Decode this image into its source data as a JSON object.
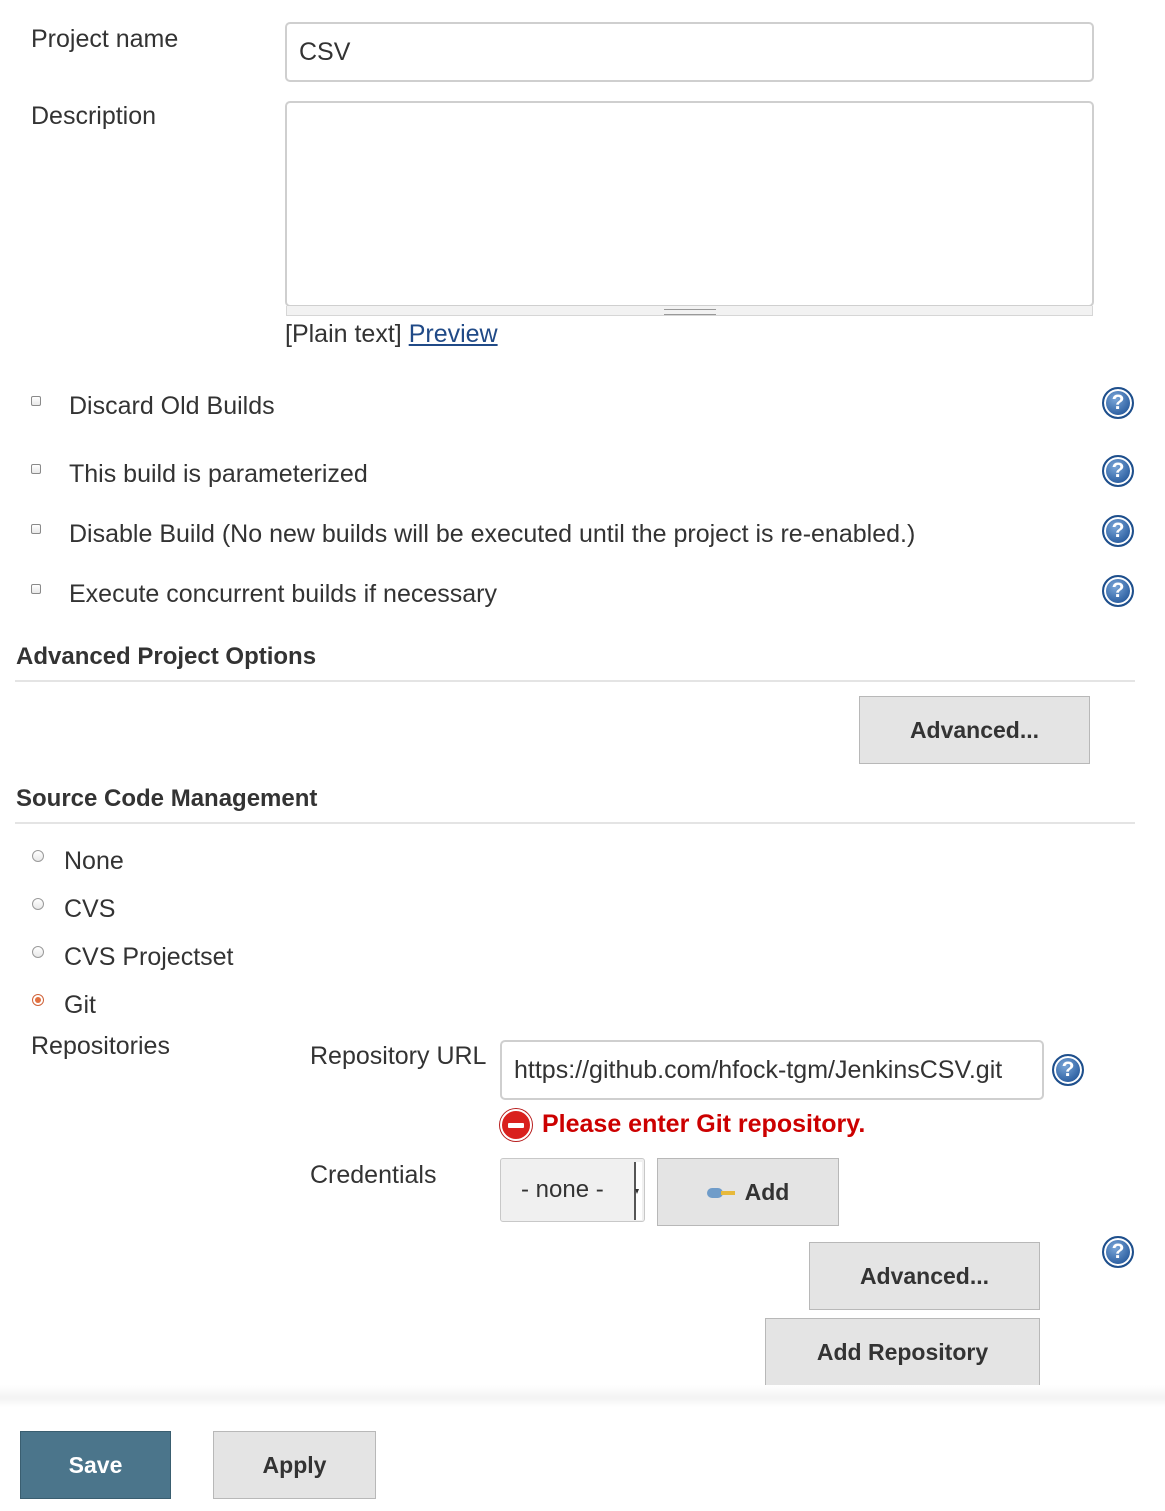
{
  "project_name": {
    "label": "Project name",
    "value": "CSV"
  },
  "description": {
    "label": "Description",
    "value": "",
    "format_plain": "[Plain text]",
    "preview_link": "Preview"
  },
  "options": [
    {
      "label": "Discard Old Builds",
      "checked": false
    },
    {
      "label": "This build is parameterized",
      "checked": false
    },
    {
      "label": "Disable Build (No new builds will be executed until the project is re-enabled.)",
      "checked": false
    },
    {
      "label": "Execute concurrent builds if necessary",
      "checked": false
    }
  ],
  "help_glyph": "?",
  "advanced_project_options": {
    "title": "Advanced Project Options",
    "advanced_button": "Advanced..."
  },
  "scm": {
    "title": "Source Code Management",
    "choices": [
      {
        "label": "None",
        "selected": false
      },
      {
        "label": "CVS",
        "selected": false
      },
      {
        "label": "CVS Projectset",
        "selected": false
      },
      {
        "label": "Git",
        "selected": true
      }
    ],
    "repositories_label": "Repositories",
    "repository_url_label": "Repository URL",
    "repository_url_value": "https://github.com/hfock-tgm/JenkinsCSV.git",
    "error_message": "Please enter Git repository.",
    "credentials_label": "Credentials",
    "credentials_selected": "- none -",
    "add_button": "Add",
    "advanced_button": "Advanced...",
    "add_repository_button": "Add Repository"
  },
  "footer": {
    "save_label": "Save",
    "apply_label": "Apply"
  },
  "colors": {
    "primary_button": "#4b758b",
    "error": "#cc0000",
    "link": "#204a87",
    "radio_selected": "#e2703f"
  },
  "icons": [
    "help-icon",
    "error-icon",
    "key-icon"
  ]
}
